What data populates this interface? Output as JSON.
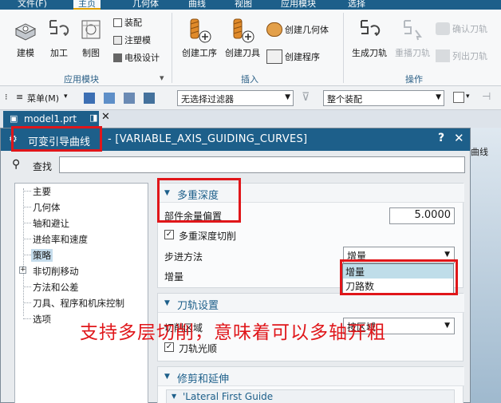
{
  "menu": [
    "文件(F)",
    "主页",
    "几何体",
    "曲线",
    "视图",
    "应用模块",
    "选择"
  ],
  "ribbon": {
    "app_group": {
      "label": "应用模块",
      "buttons": [
        "建模",
        "加工",
        "制图"
      ],
      "small": [
        "装配",
        "注塑模",
        "电极设计"
      ]
    },
    "insert_group": {
      "label": "插入",
      "buttons": [
        "创建工序",
        "创建刀具"
      ],
      "small": [
        "创建几何体",
        "创建程序"
      ]
    },
    "ops_group": {
      "label": "操作",
      "buttons": [
        "生成刀轨",
        "重播刀轨"
      ],
      "small": [
        "确认刀轨",
        "列出刀轨"
      ]
    }
  },
  "toolbar": {
    "menu_label": "菜单(M)",
    "filter": "无选择过滤器",
    "assembly": "整个装配"
  },
  "tab": {
    "title": "model1.prt"
  },
  "gfx_label": "曲线",
  "dialog": {
    "title_cn": "可变引导曲线",
    "title_en": "- [VARIABLE_AXIS_GUIDING_CURVES]",
    "help": "?",
    "close": "✕",
    "find_label": "查找",
    "tree": [
      "主要",
      "几何体",
      "轴和避让",
      "进给率和速度",
      "策略",
      "非切削移动",
      "方法和公差",
      "刀具、程序和机床控制",
      "选项"
    ],
    "sections": {
      "multi_depth": {
        "title": "多重深度",
        "offset_label": "部件余量偏置",
        "offset_value": "5.0000",
        "multi_cut_label": "多重深度切削",
        "step_label": "步进方法",
        "step_value": "增量",
        "increment_label": "增量",
        "options": [
          "增量",
          "刀路数"
        ]
      },
      "toolpath": {
        "title": "刀轨设置",
        "cut_region_label": "切削区域",
        "cut_region_value": "按区域",
        "smooth_label": "刀轨光顺"
      },
      "trim": {
        "title": "修剪和延伸",
        "sub_title": "'Lateral First Guide"
      }
    }
  },
  "annotation": "支持多层切削，意味着可以多轴开粗"
}
